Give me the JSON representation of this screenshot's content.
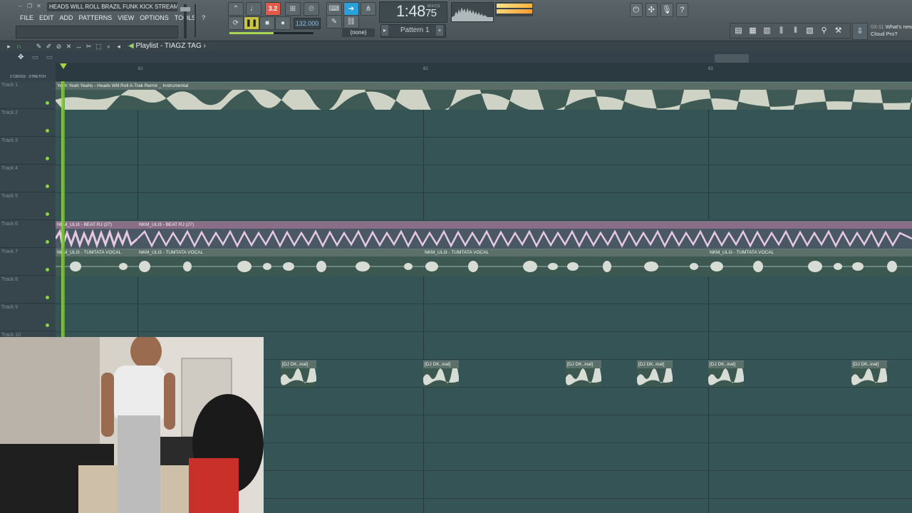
{
  "toolbar": {
    "file_title": "HEADS WILL ROLL BRAZIL FUNK KICK STREAM.f",
    "menu": [
      "FILE",
      "EDIT",
      "ADD",
      "PATTERNS",
      "VIEW",
      "OPTIONS",
      "TOOLS",
      "?"
    ],
    "tempo": "132.000",
    "pattern_counter": "3.2",
    "snap": "(none)",
    "pattern": "Pattern 1",
    "time": "1:48",
    "time_cents": "75",
    "time_sub": "M:S:CS",
    "news_date": "03-11",
    "news_text": "What's new",
    "news_text2": "Cloud Pro?"
  },
  "playlist": {
    "title": "Playlist - TIAGZ TAG",
    "header_small": "2 CROSS · STRETCH",
    "bars": [
      "61",
      "62",
      "63"
    ],
    "tracks": [
      "Track 1",
      "Track 2",
      "Track 3",
      "Track 4",
      "Track 5",
      "Track 6",
      "Track 7",
      "Track 8",
      "Track 9",
      "Track 10"
    ],
    "clips": {
      "track1": "Yeah Yeah Yeahs - Heads Will Roll A-Trak Remix _ Instrumental",
      "beat1": "NKM_ULI3 - BEAT RJ (27)",
      "beat2": "NKM_ULI3 - BEAT RJ (27)",
      "vocal1": "NKM_ULI3 - TUMTATA VOCAL",
      "vocal2": "NKM_ULI3 - TUMTATA VOCAL",
      "vocal3": "NKM_ULI3 - TUMTATA VOCAL",
      "vocal4": "NKM_ULI3 - TUMTATA VOCAL",
      "dj": "[DJ DK..inal]"
    }
  },
  "colors": {
    "accent_green": "#a7d443",
    "record_red": "#e35a48",
    "beat_clip": "#8a6d86",
    "grid_bg": "#355456"
  }
}
